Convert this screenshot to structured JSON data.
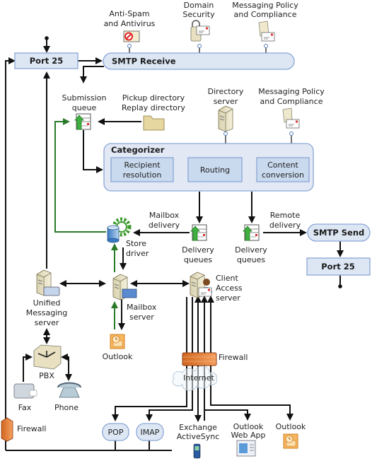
{
  "nodes": {
    "port25_in": "Port 25",
    "smtp_receive": "SMTP Receive",
    "antispam": [
      "Anti-Spam",
      "and Antivirus"
    ],
    "domain_security": [
      "Domain",
      "Security"
    ],
    "policy_top": [
      "Messaging Policy",
      "and Compliance"
    ],
    "submission_queue": [
      "Submission",
      "queue"
    ],
    "pickup": [
      "Pickup directory",
      "Replay directory"
    ],
    "directory_server": [
      "Directory",
      "server"
    ],
    "policy_cat": [
      "Messaging Policy",
      "and Compliance"
    ],
    "categorizer": "Categorizer",
    "recipient_resolution": [
      "Recipient",
      "resolution"
    ],
    "routing": "Routing",
    "content_conversion": [
      "Content",
      "conversion"
    ],
    "mailbox_delivery": [
      "Mailbox",
      "delivery"
    ],
    "remote_delivery": [
      "Remote",
      "delivery"
    ],
    "store_driver": [
      "Store",
      "driver"
    ],
    "delivery_queues_1": [
      "Delivery",
      "queues"
    ],
    "delivery_queues_2": [
      "Delivery",
      "queues"
    ],
    "smtp_send": "SMTP Send",
    "port25_out": "Port 25",
    "um_server": [
      "Unified",
      "Messaging",
      "server"
    ],
    "mailbox_server": [
      "Mailbox",
      "server"
    ],
    "cas": [
      "Client",
      "Access",
      "server"
    ],
    "outlook_local": "Outlook",
    "pbx": "PBX",
    "fax": "Fax",
    "phone": "Phone",
    "firewall_mid": "Firewall",
    "internet": "Internet",
    "firewall_left": "Firewall",
    "pop": "POP",
    "imap": "IMAP",
    "activesync": [
      "Exchange",
      "ActiveSync"
    ],
    "owa": [
      "Outlook",
      "Web App"
    ],
    "outlook_remote": "Outlook"
  },
  "colors": {
    "box_fill": "#dde7f4",
    "box_stroke": "#8aa6d6",
    "line": "#111111",
    "green_flow": "#2a7a2a",
    "firewall": "#e07a30",
    "outlook": "#f0a040"
  }
}
